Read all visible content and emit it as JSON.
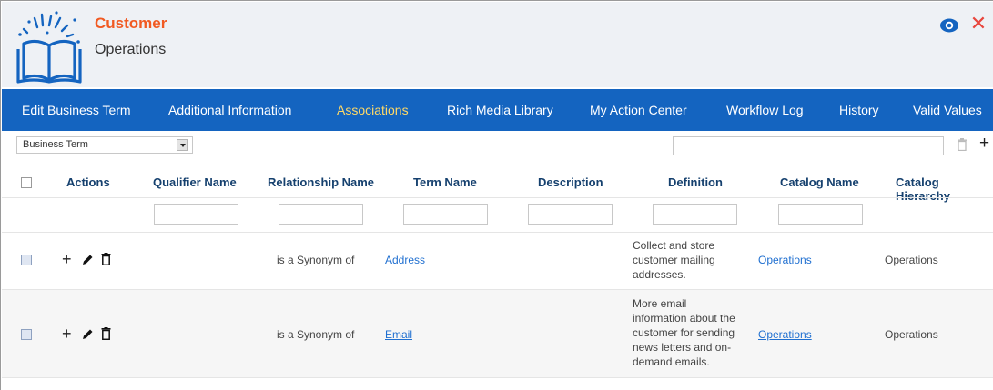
{
  "header": {
    "title": "Customer",
    "subtitle": "Operations",
    "logo_icon": "open-book-icon",
    "view_icon": "eye-icon",
    "close_icon": "close-icon",
    "close_glyph": "✕"
  },
  "tabs": [
    {
      "label": "Edit Business Term",
      "active": false
    },
    {
      "label": "Additional Information",
      "active": false
    },
    {
      "label": "Associations",
      "active": true
    },
    {
      "label": "Rich Media Library",
      "active": false
    },
    {
      "label": "My Action Center",
      "active": false
    },
    {
      "label": "Workflow Log",
      "active": false
    },
    {
      "label": "History",
      "active": false
    },
    {
      "label": "Valid Values",
      "active": false
    }
  ],
  "toolbar": {
    "object_type_selected": "Business Term",
    "search_value": "",
    "delete_icon": "trash-icon",
    "add_glyph": "+"
  },
  "table": {
    "columns": [
      "Actions",
      "Qualifier Name",
      "Relationship Name",
      "Term Name",
      "Description",
      "Definition",
      "Catalog Name",
      "Catalog Hierarchy"
    ],
    "rows": [
      {
        "qualifier": "",
        "relationship": "is a Synonym of",
        "term": "Address",
        "description": "",
        "definition": [
          "Collect and store",
          "customer mailing",
          "addresses."
        ],
        "catalog": "Operations",
        "hierarchy": "Operations"
      },
      {
        "qualifier": "",
        "relationship": "is a Synonym of",
        "term": "Email",
        "description": "",
        "definition": [
          "More email",
          "information about the",
          "customer for sending",
          "news letters and on-",
          "demand emails."
        ],
        "catalog": "Operations",
        "hierarchy": "Operations"
      }
    ],
    "action_glyph_add": "+"
  },
  "colors": {
    "brand_orange": "#f15a22",
    "tab_bar": "#1464c0",
    "active_tab": "#ffd966",
    "header_text": "#15406e",
    "link": "#1f6fd0",
    "close": "#e8453c"
  }
}
